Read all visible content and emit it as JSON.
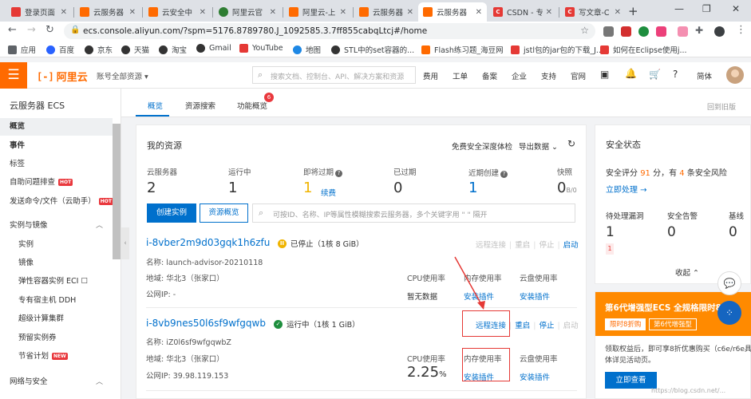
{
  "browser": {
    "tabs": [
      {
        "label": "登录页面",
        "color": "#e53935"
      },
      {
        "label": "云服务器",
        "color": "#ff6a00"
      },
      {
        "label": "云安全中",
        "color": "#ff6a00"
      },
      {
        "label": "阿里云官",
        "color": "#2e7d32"
      },
      {
        "label": "阿里云-上",
        "color": "#ff6a00"
      },
      {
        "label": "云服务器",
        "color": "#ff6a00"
      },
      {
        "label": "云服务器",
        "color": "#ff6a00"
      },
      {
        "label": "CSDN - 专",
        "color": "#e53935"
      },
      {
        "label": "写文章-C",
        "color": "#e53935"
      }
    ],
    "url": "ecs.console.aliyun.com/?spm=5176.8789780.J_1092585.3.7ff855cabqLtcj#/home",
    "bookmarks": [
      {
        "label": "应用",
        "color": "#5f6368"
      },
      {
        "label": "百度",
        "color": "#2962ff"
      },
      {
        "label": "京东",
        "color": "#333333"
      },
      {
        "label": "天猫",
        "color": "#333333"
      },
      {
        "label": "淘宝",
        "color": "#333333"
      },
      {
        "label": "Gmail",
        "color": "#333333"
      },
      {
        "label": "YouTube",
        "color": "#e53935"
      },
      {
        "label": "地图",
        "color": "#1e88e5"
      },
      {
        "label": "STL中的set容器的...",
        "color": "#333333"
      },
      {
        "label": "Flash练习题_海豆网",
        "color": "#ff6a00"
      },
      {
        "label": "jstl包的jar包的下载_J...",
        "color": "#e53935"
      },
      {
        "label": "如何在Eclipse使用j...",
        "color": "#e53935"
      }
    ]
  },
  "topnav": {
    "logo_mark": "[-]",
    "logo_text": "阿里云",
    "account": "账号全部资源 ▾",
    "search_placeholder": "搜索文档、控制台、API、解决方案和资源",
    "links": [
      "费用",
      "工单",
      "备案",
      "企业",
      "支持",
      "官网"
    ],
    "lang": "简体"
  },
  "sidebar": {
    "title": "云服务器 ECS",
    "items": [
      {
        "label": "概览",
        "active": true
      },
      {
        "label": "事件",
        "bold": true
      },
      {
        "label": "标签"
      },
      {
        "label": "自助问题排查",
        "hot": "HOT"
      },
      {
        "label": "发送命令/文件（云助手）",
        "hot": "HOT"
      },
      {
        "label": "实例与镜像",
        "group": true
      },
      {
        "label": "实例",
        "sub": true
      },
      {
        "label": "镜像",
        "sub": true
      },
      {
        "label": "弹性容器实例 ECI ☐",
        "sub": true
      },
      {
        "label": "专有宿主机 DDH",
        "sub": true
      },
      {
        "label": "超级计算集群",
        "sub": true
      },
      {
        "label": "预留实例券",
        "sub": true
      },
      {
        "label": "节省计划",
        "sub": true,
        "hot": "NEW"
      },
      {
        "label": "网络与安全",
        "group": true
      }
    ]
  },
  "page_tabs": [
    {
      "label": "概览",
      "active": true
    },
    {
      "label": "资源搜索"
    },
    {
      "label": "功能概览"
    }
  ],
  "tab_badge": "6",
  "old_version": "回到旧版",
  "resources": {
    "title": "我的资源",
    "deep_check": "免费安全深度体检",
    "export": "导出数据",
    "stats": [
      {
        "label": "云服务器",
        "value": "2"
      },
      {
        "label": "运行中",
        "value": "1"
      },
      {
        "label": "即将过期",
        "value": "1",
        "extra": "续费"
      },
      {
        "label": "已过期",
        "value": "0"
      },
      {
        "label": "近期创建",
        "value": "1"
      },
      {
        "label": "快照",
        "value": "0",
        "unit": "B/0"
      }
    ],
    "create_btn": "创建实例",
    "overview_btn": "资源概览",
    "filter_placeholder": "可按ID、名称、IP等属性模糊搜索云服务器，多个关键字用 \" \" 隔开",
    "cpu_label": "CPU使用率",
    "mem_label": "内存使用率",
    "disk_label": "云盘使用率",
    "install_plugin": "安装插件",
    "instances": [
      {
        "id": "i-8vber2m9d03gqk1h6zfu",
        "status": "已停止（1核 8 GiB）",
        "actions": [
          "远程连接",
          "重启",
          "停止",
          "启动"
        ],
        "name": "名称: launch-advisor-20210118",
        "region": "地域: 华北3（张家口）",
        "public_ip": "公网IP: -",
        "cpu": "暂无数据"
      },
      {
        "id": "i-8vb9nes50l6sf9wfgqwb",
        "status": "运行中（1核 1 GiB）",
        "actions": [
          "远程连接",
          "重启",
          "停止",
          "启动"
        ],
        "name": "名称: iZ0l6sf9wfgqwbZ",
        "region": "地域: 华北3（张家口）",
        "public_ip": "公网IP: 39.98.119.153",
        "cpu": "2.25",
        "cpu_unit": "%"
      }
    ]
  },
  "security": {
    "title": "安全状态",
    "score_prefix": "安全评分",
    "score": "91",
    "score_unit": "分，有",
    "risk_count": "4",
    "risk_suffix": "条安全风险",
    "handle_now": "立即处理 →",
    "stats": [
      {
        "label": "待处理漏洞",
        "value": "1"
      },
      {
        "label": "安全告警",
        "value": "0"
      },
      {
        "label": "基线",
        "value": "0"
      }
    ],
    "red_badge": "1",
    "fold": "收起 ⌃"
  },
  "promo": {
    "title": "第6代增强型ECS 全规格限时8折",
    "tag1": "限时8折购",
    "tag2": "第6代增强型",
    "text": "领取权益后，即可享8折优惠购买（c6e/r6e具体详见活动页。",
    "button": "立即查看"
  },
  "watermark": "https://blog.csdn.net/...",
  "colors": {
    "brand": "#ff6a00",
    "link": "#0070cc",
    "highlight": "#e53935"
  }
}
